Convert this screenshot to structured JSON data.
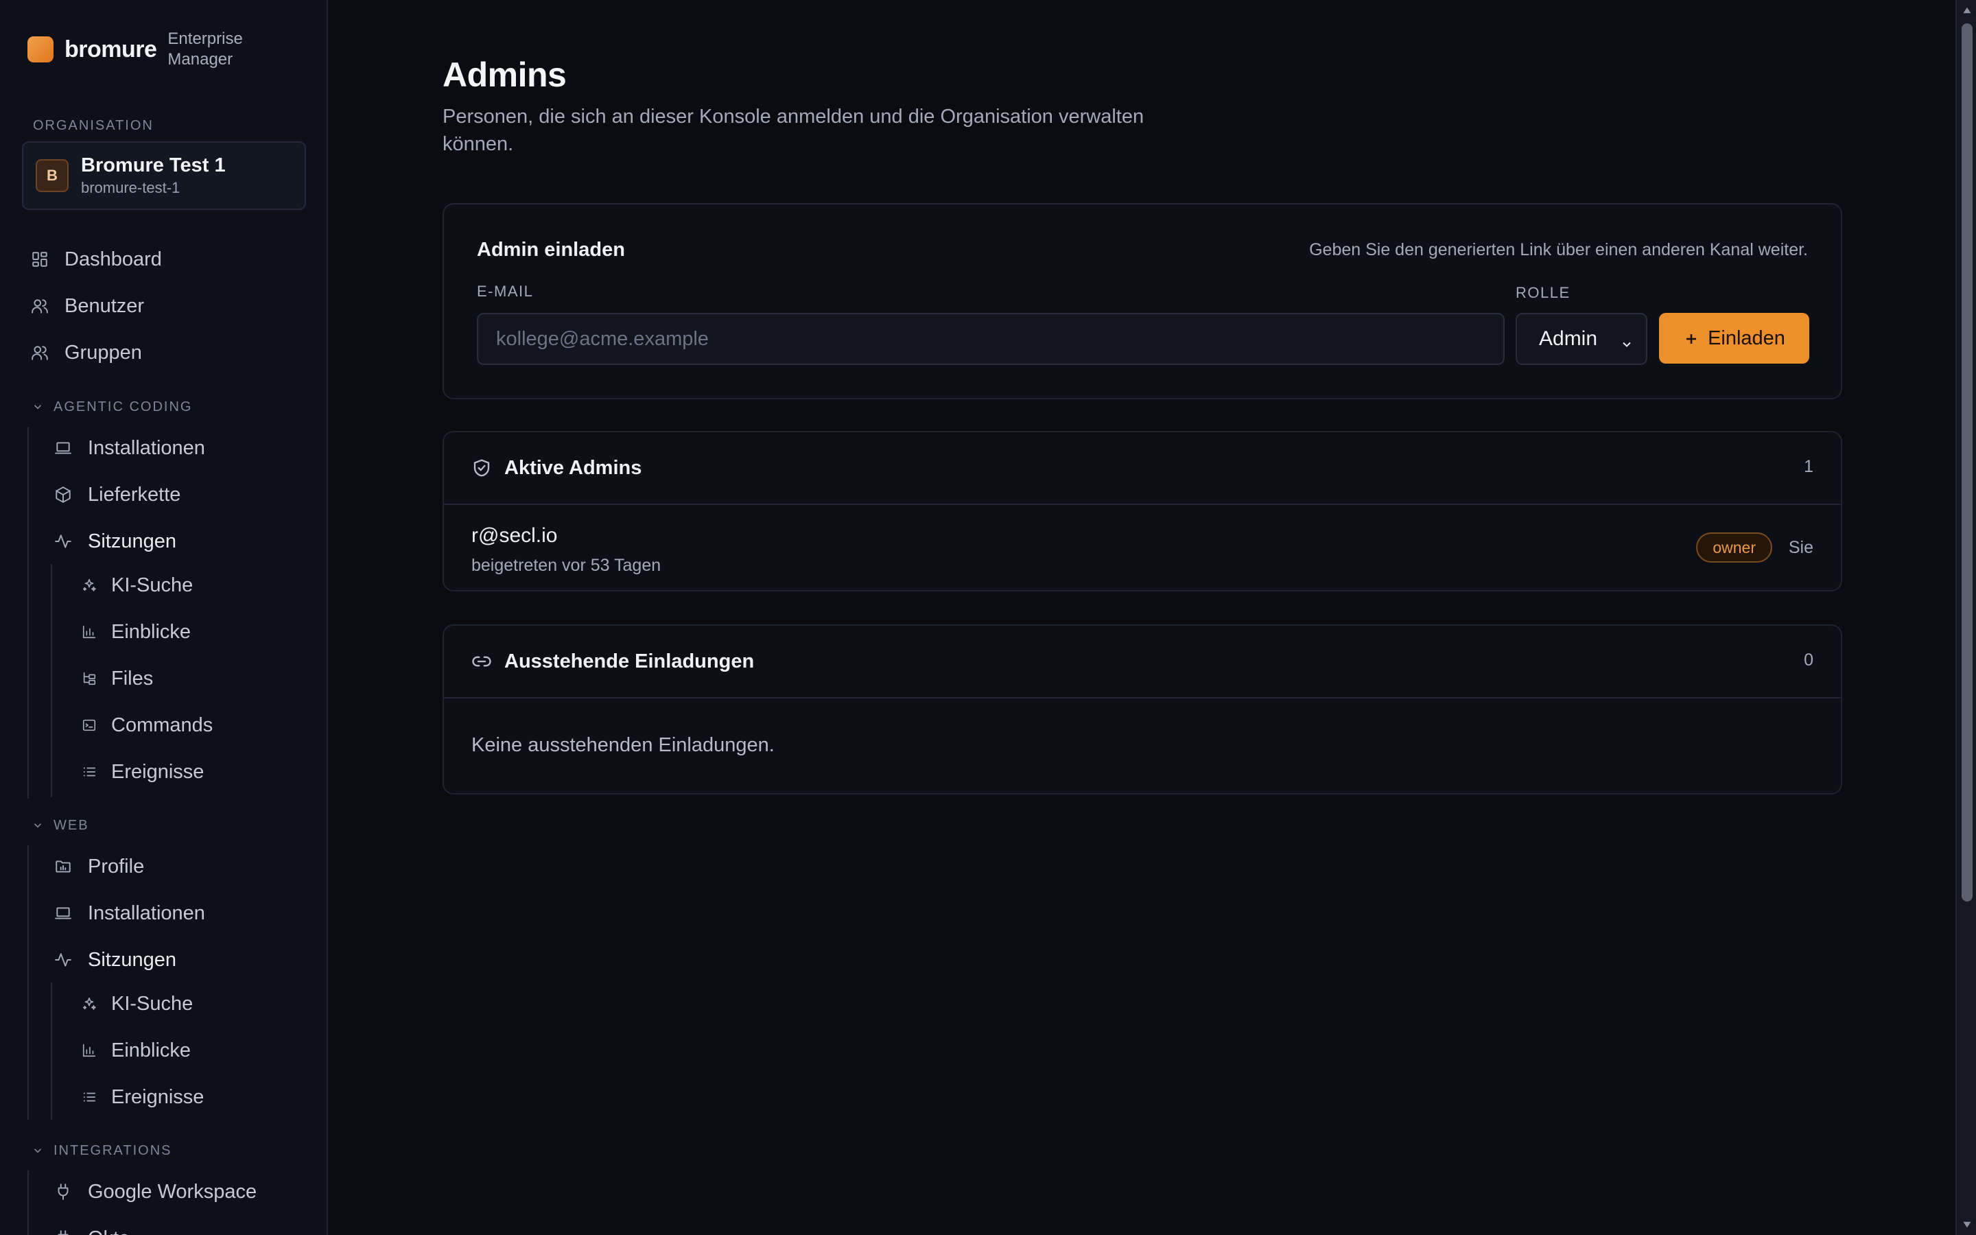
{
  "brand": {
    "name": "bromure",
    "subtitle": "Enterprise Manager"
  },
  "organisation": {
    "label": "ORGANISATION",
    "avatar_letter": "B",
    "name": "Bromure Test 1",
    "slug": "bromure-test-1"
  },
  "nav": {
    "dashboard": "Dashboard",
    "benutzer": "Benutzer",
    "gruppen": "Gruppen"
  },
  "agentic": {
    "label": "AGENTIC CODING",
    "installationen": "Installationen",
    "lieferkette": "Lieferkette",
    "sitzungen": "Sitzungen",
    "ki_suche": "KI-Suche",
    "einblicke": "Einblicke",
    "files": "Files",
    "commands": "Commands",
    "ereignisse": "Ereignisse"
  },
  "web": {
    "label": "WEB",
    "profile": "Profile",
    "installationen": "Installationen",
    "sitzungen": "Sitzungen",
    "ki_suche": "KI-Suche",
    "einblicke": "Einblicke",
    "ereignisse": "Ereignisse"
  },
  "integrations": {
    "label": "INTEGRATIONS",
    "google_workspace": "Google Workspace",
    "next_partial": "Okta"
  },
  "page": {
    "title": "Admins",
    "description": "Personen, die sich an dieser Konsole anmelden und die Organisation verwalten können."
  },
  "invite": {
    "title": "Admin einladen",
    "hint": "Geben Sie den generierten Link über einen anderen Kanal weiter.",
    "email_label": "E-MAIL",
    "email_placeholder": "kollege@acme.example",
    "email_value": "",
    "role_label": "ROLLE",
    "role_value": "Admin",
    "button_label": "Einladen"
  },
  "active_admins": {
    "title": "Aktive Admins",
    "count": "1",
    "rows": [
      {
        "email": "r@secl.io",
        "joined": "beigetreten vor 53 Tagen",
        "badge": "owner",
        "self_label": "Sie"
      }
    ]
  },
  "pending_invites": {
    "title": "Ausstehende Einladungen",
    "count": "0",
    "empty_message": "Keine ausstehenden Einladungen."
  },
  "colors": {
    "accent": "#ed8f2b",
    "background": "#0a0c12",
    "sidebar": "#0d1018",
    "badge_border": "#7a4c1c"
  }
}
